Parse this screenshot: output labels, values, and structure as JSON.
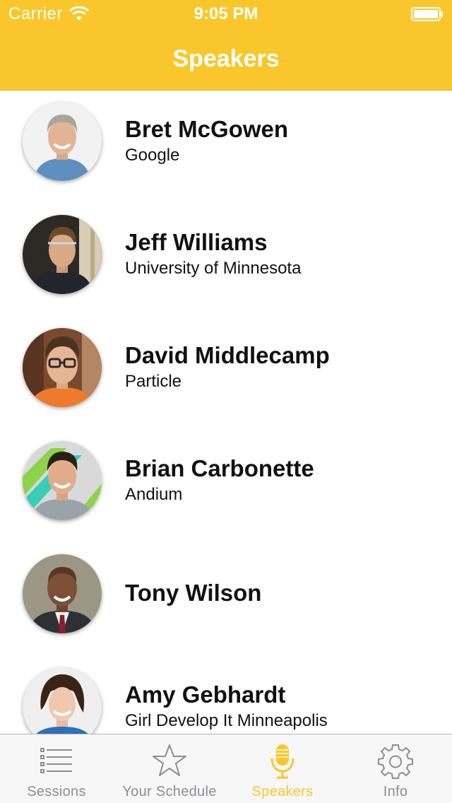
{
  "status_bar": {
    "carrier": "Carrier",
    "time": "9:05 PM",
    "icons": [
      "wifi-icon",
      "battery-icon"
    ]
  },
  "nav": {
    "title": "Speakers"
  },
  "speakers": [
    {
      "name": "Bret McGowen",
      "org": "Google"
    },
    {
      "name": "Jeff Williams",
      "org": "University of Minnesota"
    },
    {
      "name": "David Middlecamp",
      "org": "Particle"
    },
    {
      "name": "Brian Carbonette",
      "org": "Andium"
    },
    {
      "name": "Tony Wilson",
      "org": ""
    },
    {
      "name": "Amy Gebhardt",
      "org": "Girl Develop It Minneapolis"
    }
  ],
  "tabs": [
    {
      "label": "Sessions",
      "icon": "list-icon",
      "active": false
    },
    {
      "label": "Your Schedule",
      "icon": "star-icon",
      "active": false
    },
    {
      "label": "Speakers",
      "icon": "microphone-icon",
      "active": true
    },
    {
      "label": "Info",
      "icon": "gear-icon",
      "active": false
    }
  ],
  "colors": {
    "accent": "#f9c72c",
    "inactive_tab": "#8e8e93",
    "text": "#111111"
  }
}
